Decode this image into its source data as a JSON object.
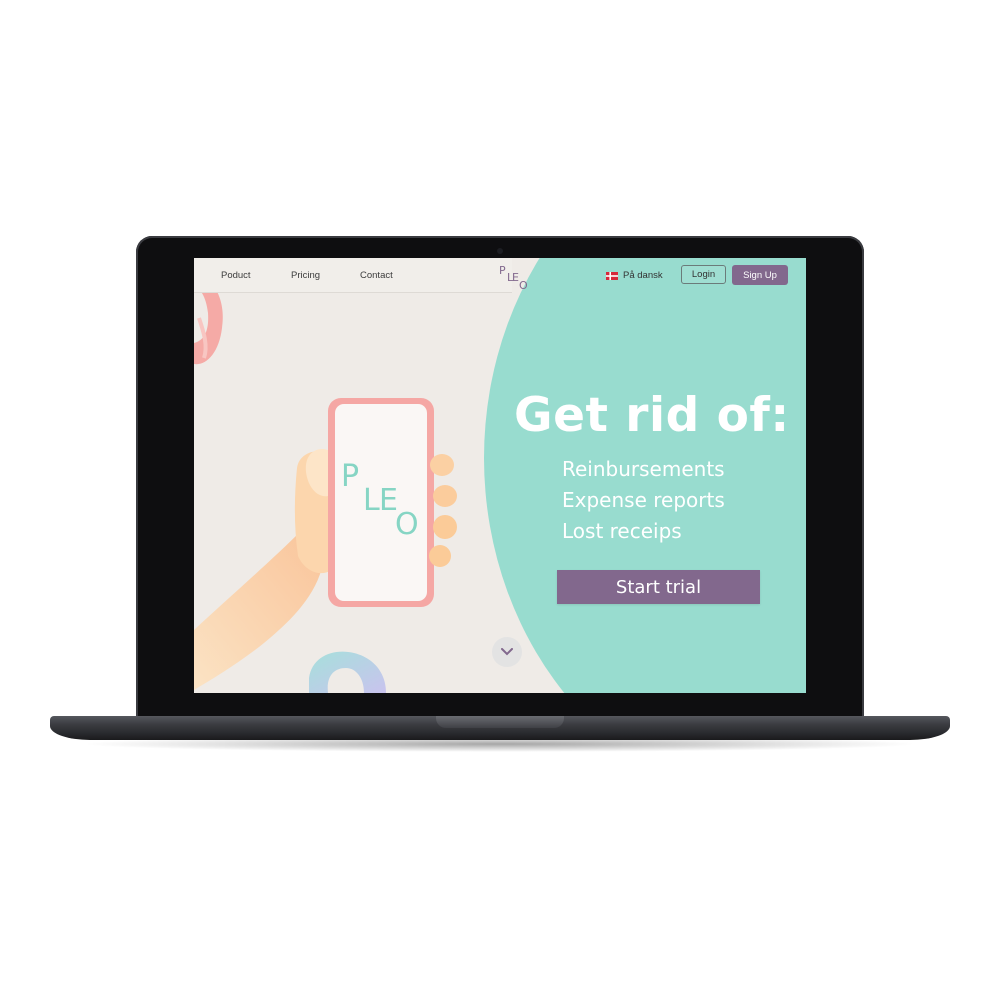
{
  "nav": {
    "links": [
      "Poduct",
      "Pricing",
      "Contact"
    ],
    "logo_text": "PLEO",
    "language_label": "På dansk",
    "login_label": "Login",
    "signup_label": "Sign Up"
  },
  "hero": {
    "title": "Get rid of:",
    "items": [
      "Reinbursements",
      "Expense reports",
      "Lost receips"
    ],
    "cta_label": "Start trial",
    "phone_logo_text": "PLEO"
  },
  "colors": {
    "accent_mint": "#98dccf",
    "brand_purple": "#82688d",
    "background": "#efebe7",
    "phone_pink": "#f5a7a4"
  },
  "icons": [
    "denmark-flag-icon",
    "chevron-down-icon",
    "pleo-logo"
  ]
}
